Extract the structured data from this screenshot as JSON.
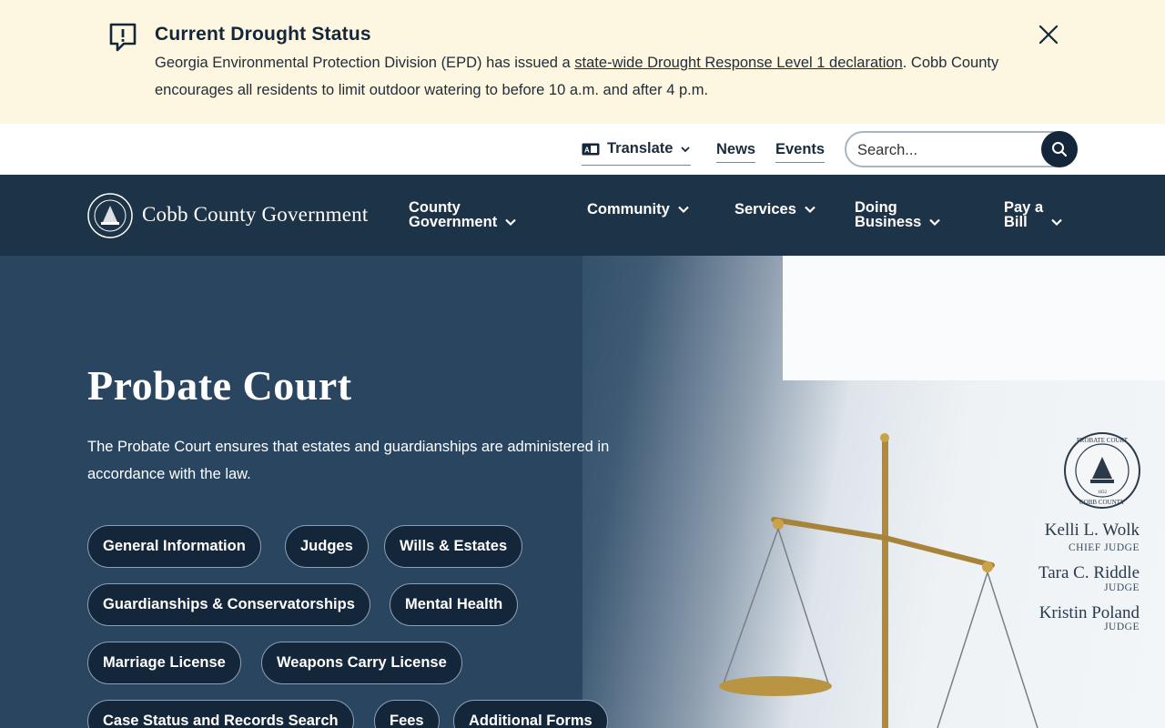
{
  "alert": {
    "title": "Current Drought Status",
    "body_before": "Georgia Environmental Protection Division (EPD) has issued a ",
    "link_text": "state-wide Drought Response Level 1 declaration",
    "body_after": ". Cobb County encourages all residents to limit outdoor watering to before 10 a.m. and after 4 p.m."
  },
  "utility": {
    "translate": "Translate",
    "links": [
      "News",
      "Events"
    ],
    "search_placeholder": "Search..."
  },
  "nav": {
    "logo_text": "Cobb County Government",
    "items": [
      {
        "line1": "County",
        "line2": "Government"
      },
      {
        "line1": "Community",
        "line2": ""
      },
      {
        "line1": "Services",
        "line2": ""
      },
      {
        "line1": "Doing",
        "line2": "Business"
      },
      {
        "line1": "Pay a",
        "line2": "Bill"
      }
    ]
  },
  "hero": {
    "title": "Probate Court",
    "description": "The Probate Court ensures that estates and guardianships are administered in accordance with the law.",
    "buttons": [
      "General Information",
      "Judges",
      "Wills & Estates",
      "Guardianships & Conservatorships",
      "Mental Health",
      "Marriage License",
      "Weapons Carry License",
      "Case Status and Records Search",
      "Fees",
      "Additional Forms"
    ],
    "judges": [
      {
        "name": "Kelli L. Wolk",
        "role": "CHIEF JUDGE"
      },
      {
        "name": "Tara C. Riddle",
        "role": "JUDGE"
      },
      {
        "name": "Kristin Poland",
        "role": "JUDGE"
      }
    ],
    "seal_text_top": "PROBATE COURT",
    "seal_text_bottom": "COBB COUNTY",
    "seal_year": "1832"
  },
  "colors": {
    "navy": "#1d3347",
    "pill": "#14263a",
    "alert_bg": "#fdf6e1"
  }
}
